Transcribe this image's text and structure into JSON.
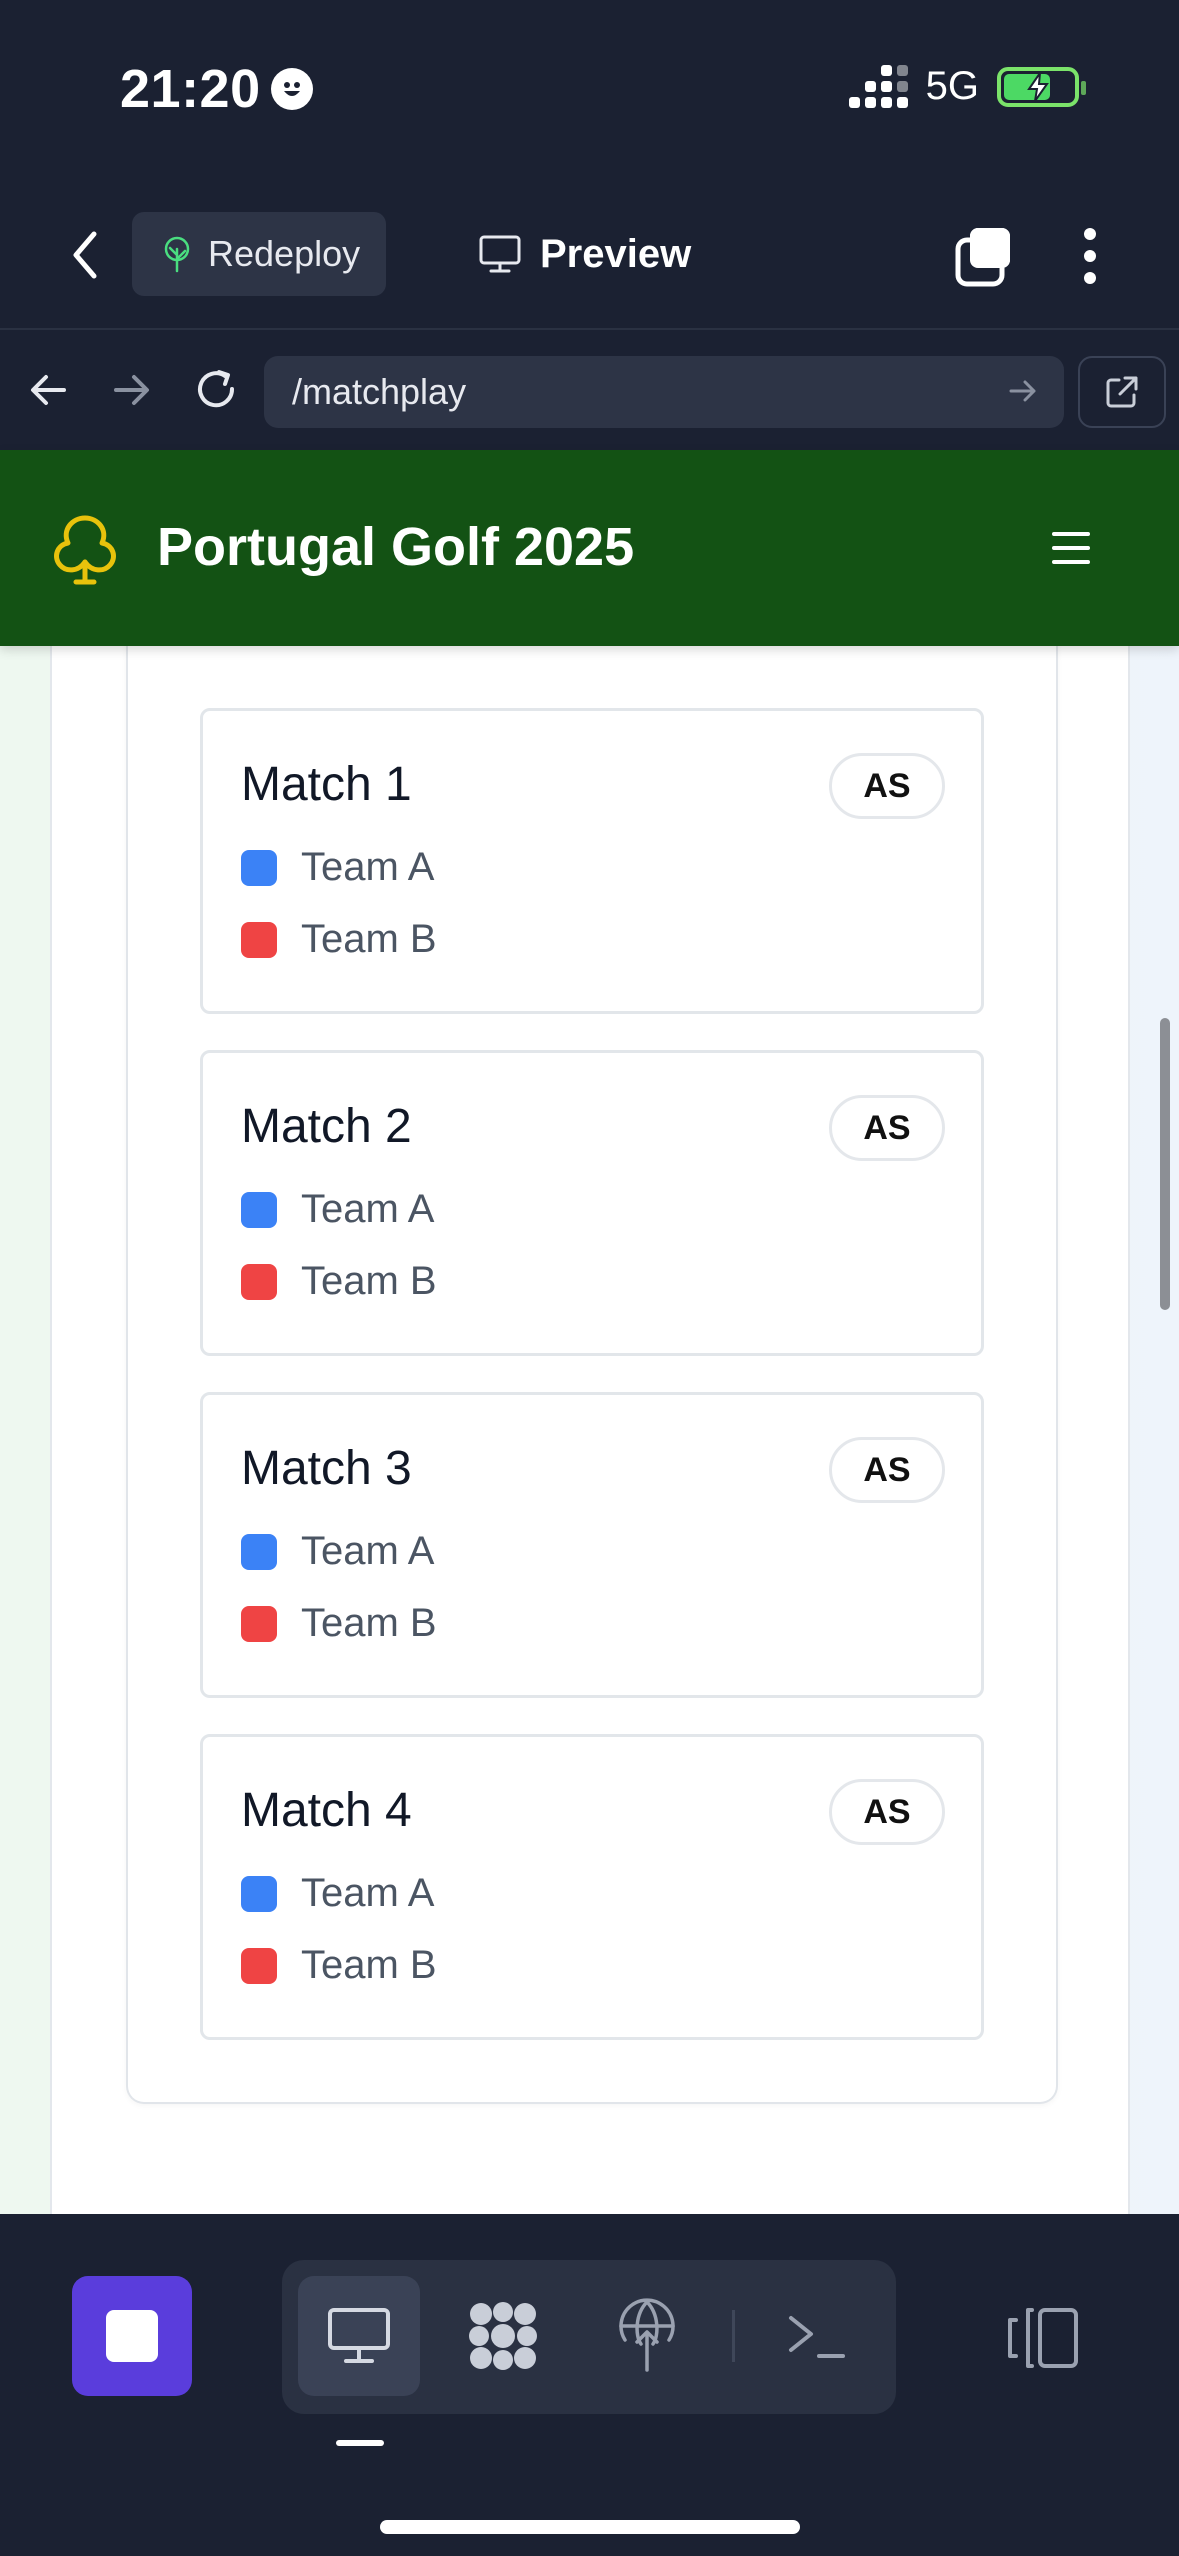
{
  "status_bar": {
    "time": "21:20",
    "network": "5G",
    "battery_level": 0.62,
    "battery_charging": true
  },
  "app_bar": {
    "redeploy_label": "Redeploy",
    "preview_label": "Preview"
  },
  "url_bar": {
    "url": "/matchplay"
  },
  "site": {
    "title": "Portugal Golf 2025",
    "brand_color": "#135214",
    "logo_color": "#e8c20c"
  },
  "matches": [
    {
      "title": "Match 1",
      "score": "AS",
      "teams": [
        {
          "name": "Team A",
          "color": "#3b82f6"
        },
        {
          "name": "Team B",
          "color": "#ef4444"
        }
      ]
    },
    {
      "title": "Match 2",
      "score": "AS",
      "teams": [
        {
          "name": "Team A",
          "color": "#3b82f6"
        },
        {
          "name": "Team B",
          "color": "#ef4444"
        }
      ]
    },
    {
      "title": "Match 3",
      "score": "AS",
      "teams": [
        {
          "name": "Team A",
          "color": "#3b82f6"
        },
        {
          "name": "Team B",
          "color": "#ef4444"
        }
      ]
    },
    {
      "title": "Match 4",
      "score": "AS",
      "teams": [
        {
          "name": "Team A",
          "color": "#3b82f6"
        },
        {
          "name": "Team B",
          "color": "#ef4444"
        }
      ]
    }
  ],
  "bottom_bar": {
    "accent_color": "#5a3ddc",
    "tools": [
      "desktop-icon",
      "apps-icon",
      "deploy-icon",
      "terminal-icon"
    ],
    "active_tool": "desktop-icon"
  }
}
